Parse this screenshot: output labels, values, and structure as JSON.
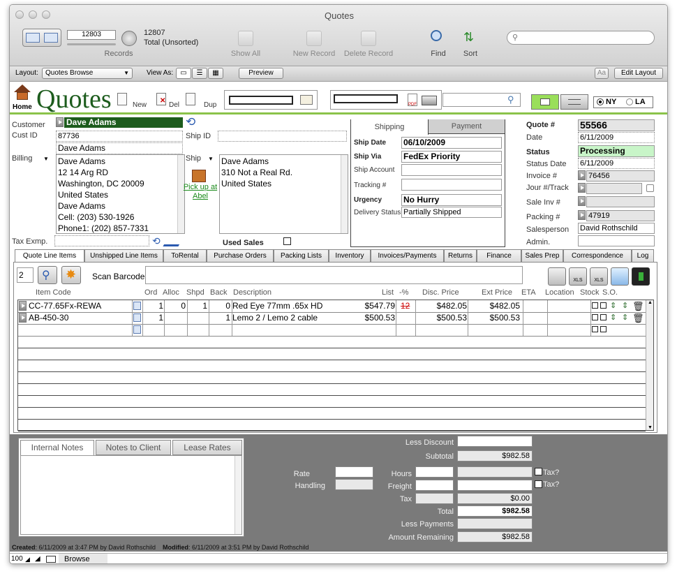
{
  "window": {
    "title": "Quotes"
  },
  "toolbar": {
    "record_number": "12803",
    "record_count": "12807",
    "total_label": "Total (Unsorted)",
    "records_label": "Records",
    "show_all": "Show All",
    "new_record": "New Record",
    "delete_record": "Delete Record",
    "find": "Find",
    "sort": "Sort",
    "search_placeholder": ""
  },
  "layoutbar": {
    "layout_label": "Layout:",
    "layout_value": "Quotes Browse",
    "view_as_label": "View As:",
    "preview": "Preview",
    "aa": "Aa",
    "edit_layout": "Edit Layout"
  },
  "header": {
    "home_label": "Home",
    "title": "Quotes",
    "new_label": "New",
    "del_label": "Del",
    "dup_label": "Dup",
    "pdf_label": "PDF",
    "ny_label": "NY",
    "la_label": "LA"
  },
  "customer": {
    "customer_label": "Customer",
    "customer_name": "Dave Adams",
    "cust_id_label": "Cust ID",
    "cust_id": "87736",
    "ship_id_label": "Ship ID",
    "ship_id": "",
    "contact_name": "Dave Adams",
    "billing_label": "Billing",
    "billing_lines": [
      "Dave Adams",
      "12 14 Arg RD",
      "Washington, DC 20009",
      "United States",
      "Dave Adams",
      "Cell: (203) 530-1926",
      "Phone1: (202) 857-7331"
    ],
    "ship_label": "Ship",
    "ship_lines": [
      "Dave Adams",
      "310 Not a Real Rd.",
      "United States"
    ],
    "pickup_label_1": "Pick up at",
    "pickup_label_2": "Abel",
    "tax_exmp_label": "Tax Exmp.",
    "used_sales_label": "Used Sales"
  },
  "shipping": {
    "tab_shipping": "Shipping",
    "tab_payment": "Payment",
    "ship_date_label": "Ship Date",
    "ship_date": "06/10/2009",
    "ship_via_label": "Ship Via",
    "ship_via": "FedEx Priority",
    "ship_account_label": "Ship Account",
    "tracking_label": "Tracking #",
    "urgency_label": "Urgency",
    "urgency": "No Hurry",
    "delivery_status_label": "Delivery Status",
    "delivery_status": "Partially Shipped"
  },
  "quote": {
    "quote_label": "Quote #",
    "quote_number": "55566",
    "date_label": "Date",
    "date": "6/11/2009",
    "status_label": "Status",
    "status": "Processing",
    "status_date_label": "Status Date",
    "status_date": "6/11/2009",
    "invoice_label": "Invoice #",
    "invoice": "76456",
    "jour_label": "Jour #/Track",
    "sale_inv_label": "Sale Inv #",
    "packing_label": "Packing #",
    "packing": "47919",
    "salesperson_label": "Salesperson",
    "salesperson": "David Rothschild",
    "admin_label": "Admin."
  },
  "tabs": [
    "Quote Line Items",
    "Unshipped Line Items",
    "ToRental",
    "Purchase Orders",
    "Packing Lists",
    "Inventory",
    "Invoices/Payments",
    "Returns",
    "Finance",
    "Sales Prep",
    "Correspondence",
    "Log"
  ],
  "lineitems": {
    "qty_input": "2",
    "scan_barcode_label": "Scan Barcode",
    "headers": {
      "item_code": "Item Code",
      "ord": "Ord",
      "alloc": "Alloc",
      "shpd": "Shpd",
      "back": "Back",
      "description": "Description",
      "list": "List",
      "pct": "-%",
      "disc_price": "Disc. Price",
      "ext_price": "Ext Price",
      "eta": "ETA",
      "location": "Location",
      "stock": "Stock",
      "so": "S.O."
    },
    "rows": [
      {
        "item_code": "CC-77.65Fx-REWA",
        "ord": "1",
        "alloc": "0",
        "shpd": "1",
        "back": "0",
        "description": "Red Eye 77mm .65x HD",
        "list": "$547.79",
        "pct": "12",
        "disc_price": "$482.05",
        "ext_price": "$482.05"
      },
      {
        "item_code": "AB-450-30",
        "ord": "1",
        "alloc": "",
        "shpd": "",
        "back": "1",
        "description": "Lemo 2 / Lemo 2 cable",
        "list": "$500.53",
        "pct": "",
        "disc_price": "$500.53",
        "ext_price": "$500.53"
      }
    ]
  },
  "notes": {
    "tab_internal": "Internal Notes",
    "tab_client": "Notes to Client",
    "tab_lease": "Lease Rates"
  },
  "totals": {
    "less_discount_label": "Less Discount",
    "less_discount": "",
    "subtotal_label": "Subtotal",
    "subtotal": "$982.58",
    "rate_label": "Rate",
    "handling_label": "Handling",
    "hours_label": "Hours",
    "freight_label": "Freight",
    "tax_q_label": "Tax?",
    "tax_label": "Tax",
    "tax": "$0.00",
    "total_label": "Total",
    "total": "$982.58",
    "less_payments_label": "Less Payments",
    "amount_remaining_label": "Amount Remaining",
    "amount_remaining": "$982.58"
  },
  "footer": {
    "created_label": "Created",
    "created_value": ": 6/11/2009 at 3:47 PM by David Rothschild",
    "modified_label": "Modified",
    "modified_value": ": 6/11/2009 at 3:51 PM by David Rothschild",
    "zoom": "100",
    "mode": "Browse"
  },
  "colors": {
    "accent_green": "#1d5c1d",
    "status_green": "#c8f5c8",
    "panel_gray": "#7a7a7a"
  }
}
